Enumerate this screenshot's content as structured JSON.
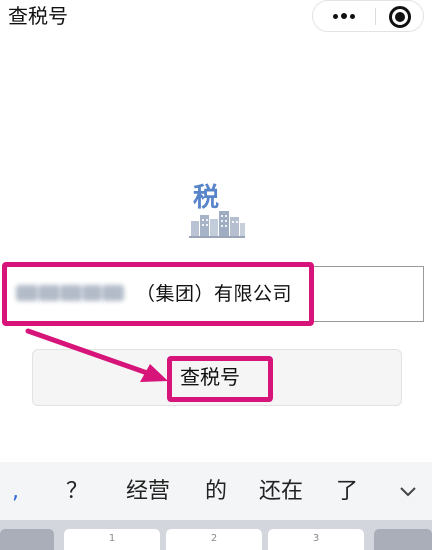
{
  "nav": {
    "title": "查税号",
    "capsule": {
      "more_icon": "more-dots-icon",
      "close_icon": "target-close-icon"
    }
  },
  "logo": {
    "char": "税",
    "icon": "tax-logo-icon"
  },
  "search": {
    "value_visible": "（集团）有限公司"
  },
  "query_button": {
    "label": "查税号"
  },
  "keyboard": {
    "candidates": [
      ",",
      "？",
      "经营",
      "的",
      "还在",
      "了"
    ],
    "collapse_icon": "chevron-down-icon",
    "keys": [
      "1",
      "2",
      "3"
    ]
  },
  "colors": {
    "highlight": "#d6147a",
    "logo_blue": "#3c6fc0",
    "comma_blue": "#2f6bd8"
  }
}
